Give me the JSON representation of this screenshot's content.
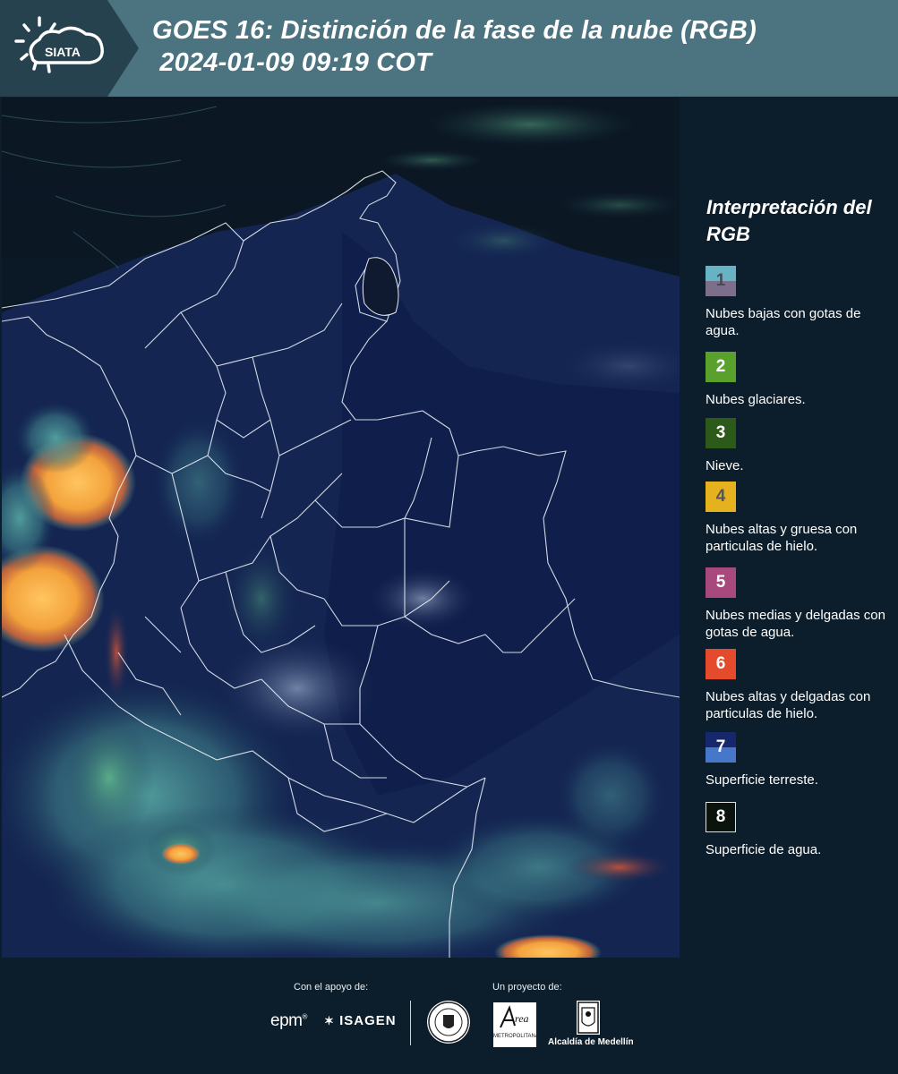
{
  "header": {
    "logo_text": "SIATA",
    "title_line1": "GOES 16: Distinción de la fase de la nube (RGB)",
    "title_line2": " 2024-01-09 09:19 COT"
  },
  "legend": {
    "title": "Interpretación del RGB",
    "items": [
      {
        "number": "1",
        "label": "Nubes bajas con gotas de agua.",
        "color_top": "#66b3c4",
        "color_bottom": "#7b6f8c",
        "num_color": "#4a4a55"
      },
      {
        "number": "2",
        "label": "Nubes glaciares.",
        "color_top": "#5aa02c",
        "color_bottom": "#5aa02c",
        "num_color": "#ffffff"
      },
      {
        "number": "3",
        "label": "Nieve.",
        "color_top": "#2d5a1b",
        "color_bottom": "#2d5a1b",
        "num_color": "#ffffff"
      },
      {
        "number": "4",
        "label": "Nubes altas y gruesa con particulas de hielo.",
        "color_top": "#e6b11e",
        "color_bottom": "#e6b11e",
        "num_color": "#555555"
      },
      {
        "number": "5",
        "label": "Nubes medias y delgadas con gotas de agua.",
        "color_top": "#a8497e",
        "color_bottom": "#a8497e",
        "num_color": "#ffffff"
      },
      {
        "number": "6",
        "label": "Nubes altas y delgadas con particulas de hielo.",
        "color_top": "#e44a2c",
        "color_bottom": "#e44a2c",
        "num_color": "#ffffff"
      },
      {
        "number": "7",
        "label": "Superficie terreste.",
        "color_top": "#16286b",
        "color_bottom": "#4777c8",
        "num_color": "#ffffff"
      },
      {
        "number": "8",
        "label": "Superficie de agua.",
        "color_top": "#0a140c",
        "color_bottom": "#0a140c",
        "num_color": "#ffffff"
      }
    ]
  },
  "footer": {
    "support_label": "Con el apoyo de:",
    "project_label": "Un proyecto de:",
    "epm": "epm",
    "isagen": "ISAGEN",
    "area_text": "METROPOLITANA",
    "alcaldia": "Alcaldía de Medellín"
  }
}
